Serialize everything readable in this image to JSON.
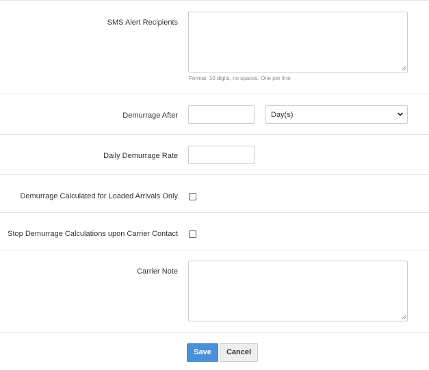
{
  "sms_alert": {
    "label": "SMS Alert Recipients",
    "value": "",
    "help": "Format: 10 digits, no spaces. One per line"
  },
  "demurrage_after": {
    "label": "Demurrage After",
    "value": "",
    "unit_selected": "Day(s)"
  },
  "daily_rate": {
    "label": "Daily Demurrage Rate",
    "value": ""
  },
  "loaded_only": {
    "label": "Demurrage Calculated for Loaded Arrivals Only",
    "checked": false
  },
  "stop_on_contact": {
    "label": "Stop Demurrage Calculations upon Carrier Contact",
    "checked": false
  },
  "carrier_note": {
    "label": "Carrier Note",
    "value": ""
  },
  "actions": {
    "save_label": "Save",
    "cancel_label": "Cancel"
  },
  "colors": {
    "primary": "#4a8fd9",
    "divider": "#e5e5e5",
    "input_border": "#cccccc"
  }
}
